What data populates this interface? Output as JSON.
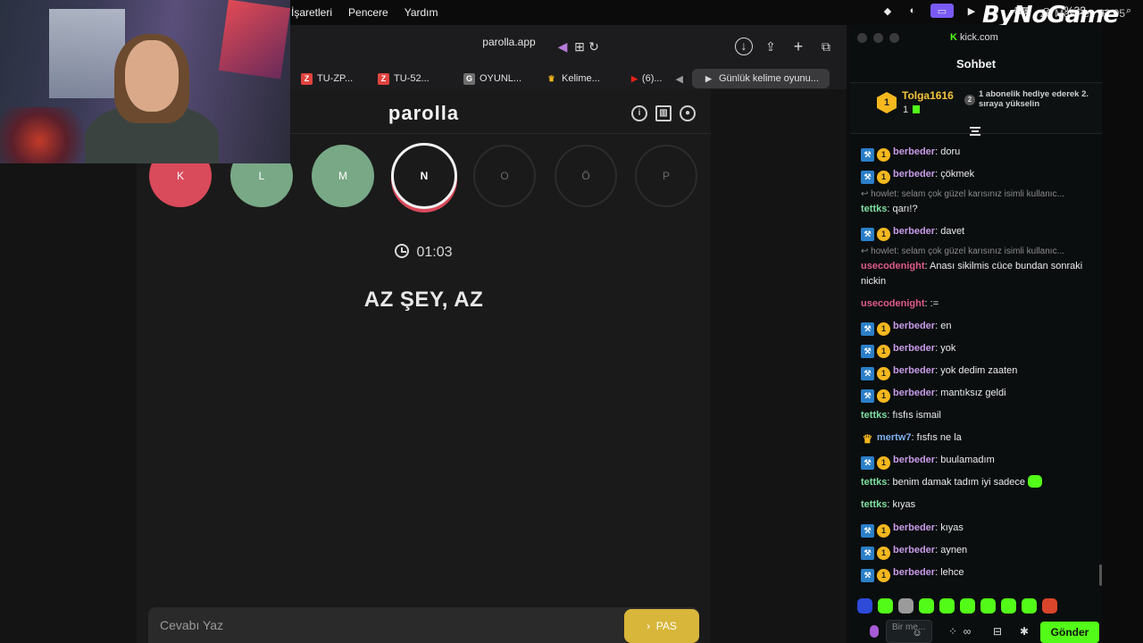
{
  "menubar": {
    "items": [
      "İşaretleri",
      "Pencere",
      "Yardım"
    ],
    "battery": "%33",
    "date": "26 Mar Per. 02:05",
    "brand": "ByNoGame"
  },
  "browser": {
    "address": "parolla.app",
    "tabs": [
      {
        "label": "TU-ZP...",
        "fav": "Z",
        "fav_color": "#e0433f"
      },
      {
        "label": "TU-52...",
        "fav": "Z",
        "fav_color": "#e0433f"
      },
      {
        "label": "OYUNL...",
        "fav": "G",
        "fav_color": "#6e6e6e"
      },
      {
        "label": "Kelime...",
        "fav": "♛",
        "fav_color": "#f5b81e"
      },
      {
        "label": "(6)...",
        "fav": "▶",
        "fav_color": "#e62117"
      },
      {
        "label": "Günlük kelime oyunu...",
        "fav": "▶",
        "fav_color": "#d8d8d8"
      }
    ]
  },
  "game": {
    "title": "parolla",
    "letters": [
      {
        "char": "K",
        "state": "wrong"
      },
      {
        "char": "L",
        "state": "right"
      },
      {
        "char": "M",
        "state": "right"
      },
      {
        "char": "N",
        "state": "current"
      },
      {
        "char": "O",
        "state": "pending"
      },
      {
        "char": "Ö",
        "state": "pending"
      },
      {
        "char": "P",
        "state": "pending"
      }
    ],
    "timer": "01:03",
    "clue": "AZ ŞEY, AZ",
    "answer_placeholder": "Cevabı Yaz",
    "pass_label": "PAS"
  },
  "chat": {
    "site": "kick.com",
    "title": "Sohbet",
    "pinned": {
      "user": "Tolga1616",
      "rank": "1",
      "count": "1",
      "info": "1 abonelik hediye ederek 2. sıraya yükselin",
      "info_rank": "2"
    },
    "messages": [
      {
        "type": "msg",
        "user": "berbeder",
        "color": "#c79be8",
        "badges": [
          "mod",
          "sub"
        ],
        "text": "doru"
      },
      {
        "type": "msg",
        "user": "berbeder",
        "color": "#c79be8",
        "badges": [
          "mod",
          "sub"
        ],
        "text": "çökmek"
      },
      {
        "type": "reply",
        "text": "howlet: selam çok güzel karısınız isimli kullanıc..."
      },
      {
        "type": "msg",
        "user": "tettks",
        "color": "#7fe0a0",
        "badges": [],
        "text": "qarı!?"
      },
      {
        "type": "msg",
        "user": "berbeder",
        "color": "#c79be8",
        "badges": [
          "mod",
          "sub"
        ],
        "text": "davet"
      },
      {
        "type": "reply",
        "text": "howlet: selam çok güzel karısınız isimli kullanıc..."
      },
      {
        "type": "msg",
        "user": "usecodenight",
        "color": "#e05a8a",
        "badges": [],
        "text": "Anası sikilmis cüce bundan sonraki nickin"
      },
      {
        "type": "msg",
        "user": "usecodenight",
        "color": "#e05a8a",
        "badges": [],
        "text": ":="
      },
      {
        "type": "msg",
        "user": "berbeder",
        "color": "#c79be8",
        "badges": [
          "mod",
          "sub"
        ],
        "text": "en"
      },
      {
        "type": "msg",
        "user": "berbeder",
        "color": "#c79be8",
        "badges": [
          "mod",
          "sub"
        ],
        "text": "yok"
      },
      {
        "type": "msg",
        "user": "berbeder",
        "color": "#c79be8",
        "badges": [
          "mod",
          "sub"
        ],
        "text": "yok dedim zaaten"
      },
      {
        "type": "msg",
        "user": "berbeder",
        "color": "#c79be8",
        "badges": [
          "mod",
          "sub"
        ],
        "text": "mantıksız geldi"
      },
      {
        "type": "msg",
        "user": "tettks",
        "color": "#7fe0a0",
        "badges": [],
        "text": "fısfıs ismail"
      },
      {
        "type": "msg",
        "user": "mertw7",
        "color": "#7fb0f0",
        "badges": [
          "crown"
        ],
        "text": "fısfıs ne la"
      },
      {
        "type": "msg",
        "user": "berbeder",
        "color": "#c79be8",
        "badges": [
          "mod",
          "sub"
        ],
        "text": "buulamadım"
      },
      {
        "type": "msg",
        "user": "tettks",
        "color": "#7fe0a0",
        "badges": [],
        "text": "benim damak tadım iyi sadece",
        "emote": true
      },
      {
        "type": "msg",
        "user": "tettks",
        "color": "#7fe0a0",
        "badges": [],
        "text": "kıyas"
      },
      {
        "type": "msg",
        "user": "berbeder",
        "color": "#c79be8",
        "badges": [
          "mod",
          "sub"
        ],
        "text": "kıyas"
      },
      {
        "type": "msg",
        "user": "berbeder",
        "color": "#c79be8",
        "badges": [
          "mod",
          "sub"
        ],
        "text": "aynen"
      },
      {
        "type": "msg",
        "user": "berbeder",
        "color": "#c79be8",
        "badges": [
          "mod",
          "sub"
        ],
        "text": "lehce"
      }
    ],
    "input_placeholder": "Bir me...",
    "send_label": "Gönder"
  }
}
